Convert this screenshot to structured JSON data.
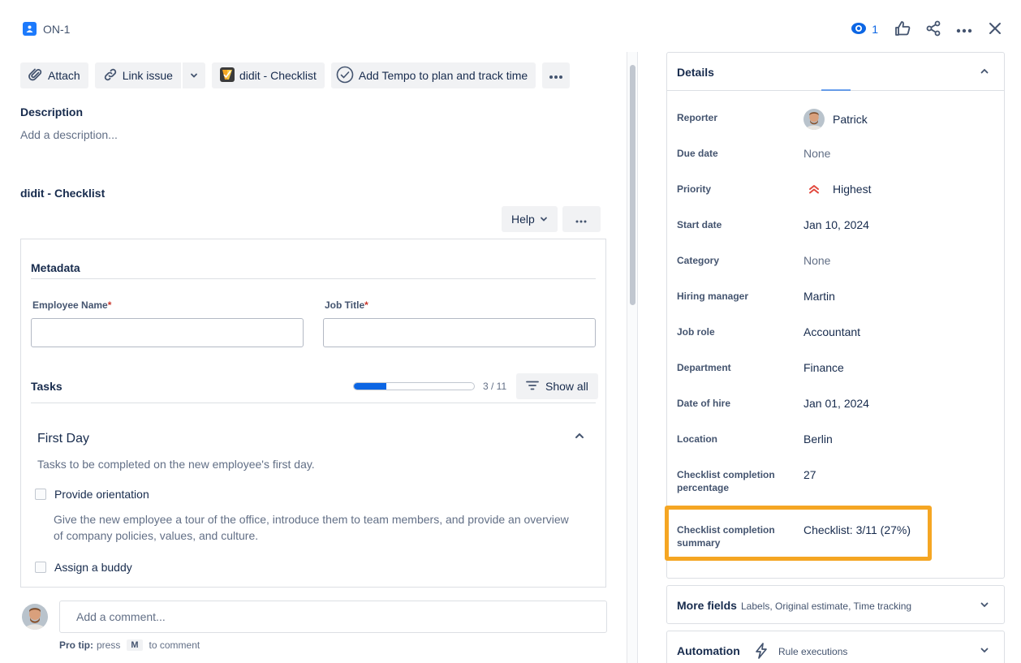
{
  "header": {
    "issue_key": "ON-1",
    "watch_count": "1"
  },
  "toolbar": {
    "attach": "Attach",
    "link_issue": "Link issue",
    "didit_checklist": "didit - Checklist",
    "tempo": "Add Tempo to plan and track time"
  },
  "description": {
    "heading": "Description",
    "placeholder": "Add a description..."
  },
  "checklist": {
    "heading": "didit - Checklist",
    "help": "Help",
    "metadata_title": "Metadata",
    "employee_name_label": "Employee Name",
    "job_title_label": "Job Title",
    "required_mark": "*",
    "employee_name_value": "",
    "job_title_value": "",
    "tasks_title": "Tasks",
    "progress_count": "3 / 11",
    "progress_fraction": 0.27,
    "show_all": "Show all",
    "section_title": "First Day",
    "section_desc": "Tasks to be completed on the new employee's first day.",
    "tasks": [
      {
        "label": "Provide orientation",
        "checked": false,
        "description": "Give the new employee a tour of the office, introduce them to team members, and provide an overview of company policies, values, and culture."
      },
      {
        "label": "Assign a buddy",
        "checked": false
      }
    ]
  },
  "comment": {
    "placeholder": "Add a comment...",
    "protip_prefix": "Pro tip:",
    "protip_press": "press",
    "protip_key": "M",
    "protip_suffix": "to comment"
  },
  "details": {
    "title": "Details",
    "rows": [
      {
        "label": "Reporter",
        "value": "Patrick"
      },
      {
        "label": "Due date",
        "value": "None"
      },
      {
        "label": "Priority",
        "value": "Highest"
      },
      {
        "label": "Start date",
        "value": "Jan 10, 2024"
      },
      {
        "label": "Category",
        "value": "None"
      },
      {
        "label": "Hiring manager",
        "value": "Martin"
      },
      {
        "label": "Job role",
        "value": "Accountant"
      },
      {
        "label": "Department",
        "value": "Finance"
      },
      {
        "label": "Date of hire",
        "value": "Jan 01, 2024"
      },
      {
        "label": "Location",
        "value": "Berlin"
      },
      {
        "label": "Checklist completion percentage",
        "value": "27"
      },
      {
        "label": "Checklist completion summary",
        "value": "Checklist: 3/11 (27%)"
      }
    ]
  },
  "more_fields": {
    "title": "More fields",
    "subtitle": "Labels, Original estimate, Time tracking"
  },
  "automation": {
    "title": "Automation",
    "subtitle": "Rule executions"
  },
  "colors": {
    "accent": "#0c66e4",
    "highlight": "#f5a623",
    "priority": "#e2483d",
    "required": "#c9372c"
  }
}
